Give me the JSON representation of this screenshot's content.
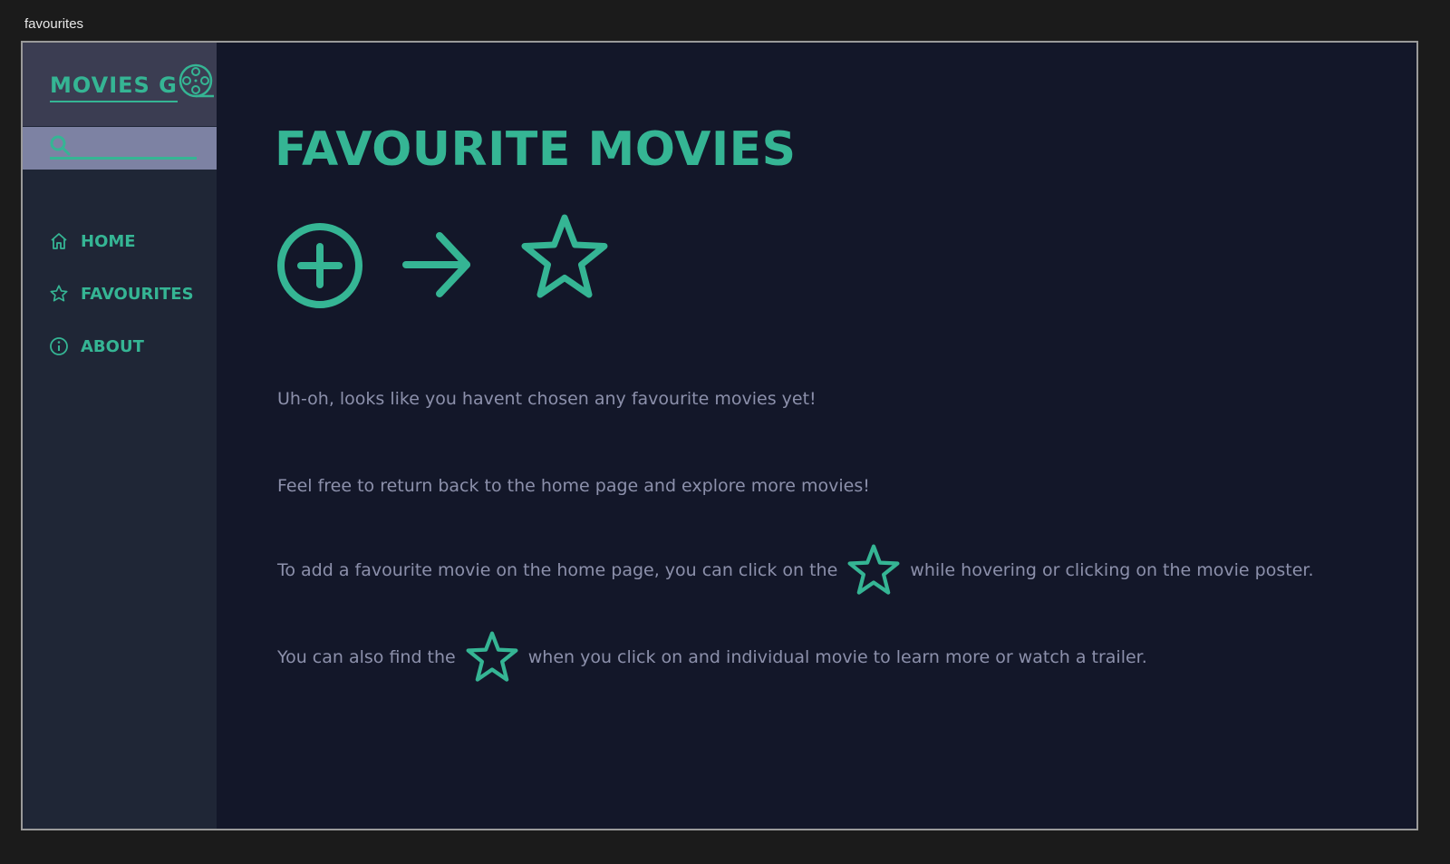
{
  "window": {
    "title": "favourites"
  },
  "brand": {
    "logo_text": "MOVIES G",
    "logo_icon": "film-reel-icon"
  },
  "search": {
    "placeholder": "",
    "value": "",
    "icon": "search-icon"
  },
  "sidebar": {
    "items": [
      {
        "label": "HOME",
        "icon": "home-icon"
      },
      {
        "label": "FAVOURITES",
        "icon": "star-icon"
      },
      {
        "label": "ABOUT",
        "icon": "info-icon"
      }
    ]
  },
  "main": {
    "title": "FAVOURITE MOVIES",
    "illustration_icons": [
      "plus-circle-icon",
      "arrow-right-icon",
      "star-icon"
    ],
    "messages": {
      "line1": "Uh-oh, looks like you havent chosen any favourite movies yet!",
      "line2": "Feel free to return back to the home page and explore more movies!",
      "line3_before": "To add a favourite movie on the home page, you can click on the",
      "line3_after": "while hovering or clicking  on the movie poster.",
      "line4_before": "You can also find the",
      "line4_after": "when you click on and individual movie to learn more or watch a trailer."
    }
  },
  "colors": {
    "accent": "#35b594",
    "background": "#131729",
    "sidebar": "#1f2636",
    "logo_area": "#3b3d52",
    "search_area": "#7d82a3",
    "body_text": "#8c90ab"
  }
}
